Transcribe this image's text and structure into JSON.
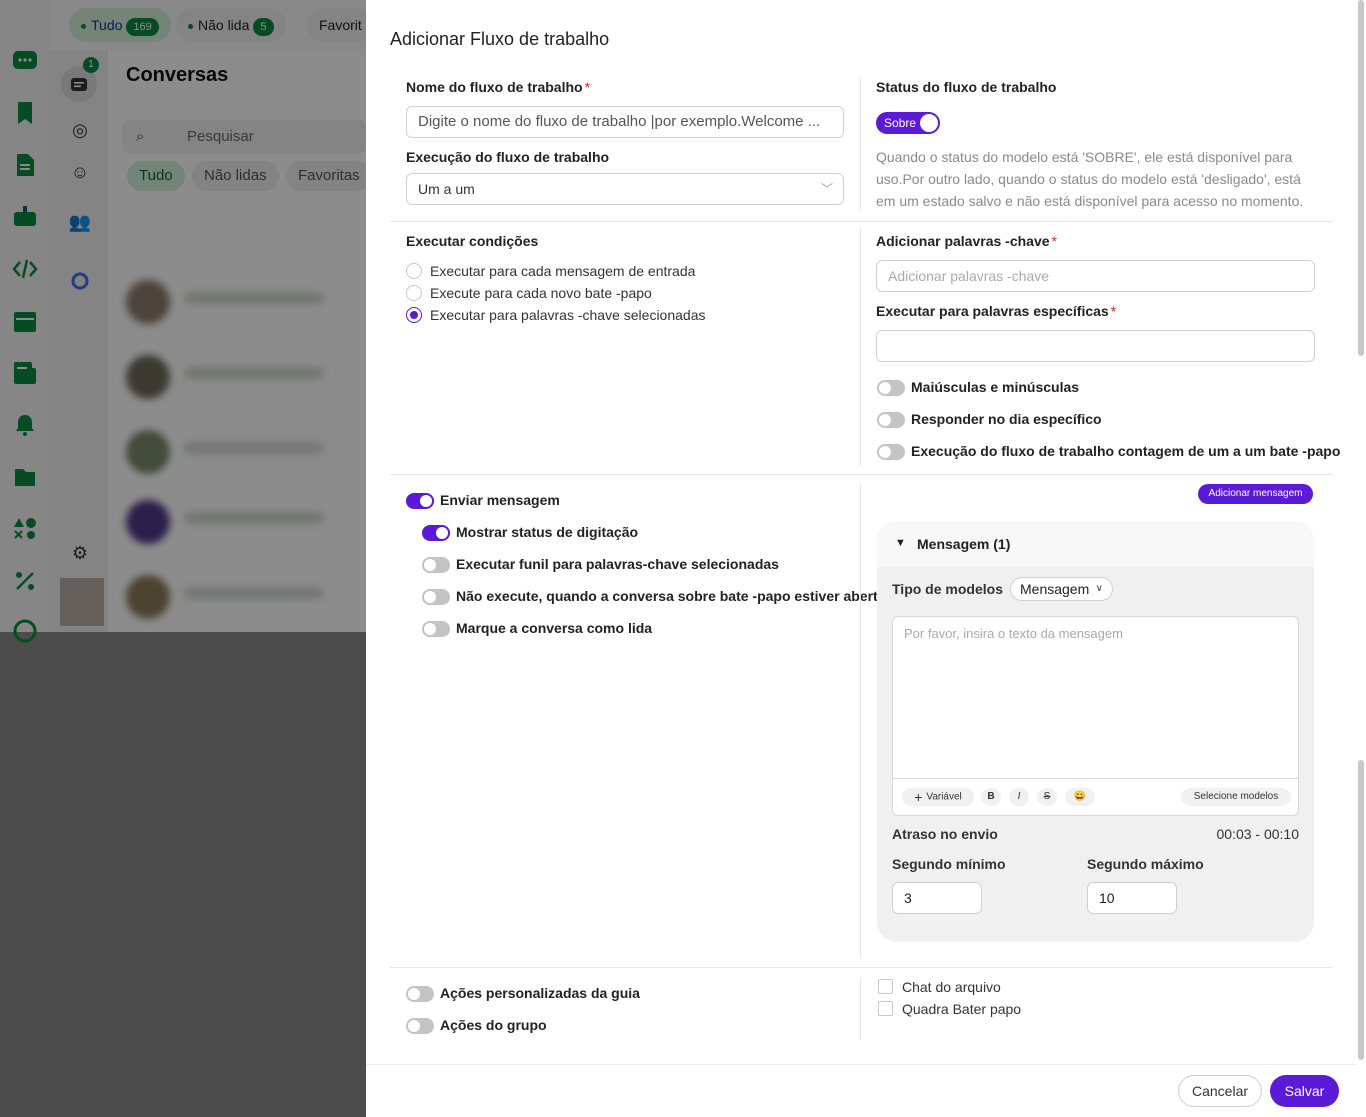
{
  "background_app": {
    "top_tabs": [
      {
        "label": "Tudo",
        "count": "169"
      },
      {
        "label": "Não lida",
        "count": "5"
      },
      {
        "label": "Favorit"
      }
    ],
    "chats_badge": "1",
    "title": "Conversas",
    "search_placeholder": "Pesquisar",
    "filters": [
      "Tudo",
      "Não lidas",
      "Favoritas"
    ]
  },
  "drawer": {
    "title": "Adicionar Fluxo de trabalho",
    "workflow_name": {
      "label": "Nome do fluxo de trabalho",
      "required_mark": "*",
      "placeholder": "Digite o nome do fluxo de trabalho |por exemplo.Welcome ..."
    },
    "execution": {
      "label": "Execução do fluxo de trabalho",
      "value": "Um a um"
    },
    "status": {
      "label": "Status do fluxo de trabalho",
      "toggle_label": "Sobre",
      "enabled": true,
      "description": "Quando o status do modelo está 'SOBRE', ele está disponível para uso.Por outro lado, quando o status do modelo está 'desligado', está em um estado salvo e não está disponível para acesso no momento."
    },
    "conditions": {
      "label": "Executar condições",
      "options": [
        "Executar para cada mensagem de entrada",
        "Execute para cada novo bate -papo",
        "Executar para palavras -chave selecionadas"
      ],
      "selected": "Executar para palavras -chave selecionadas"
    },
    "keywords": {
      "label": "Adicionar palavras -chave",
      "required_mark": "*",
      "placeholder": "Adicionar palavras -chave"
    },
    "specific_words": {
      "label": "Executar para palavras específicas",
      "required_mark": "*",
      "value": ""
    },
    "keyword_toggles": [
      {
        "label": "Maiúsculas e minúsculas",
        "on": false
      },
      {
        "label": "Responder no dia específico",
        "on": false
      },
      {
        "label": "Execução do fluxo de trabalho contagem de um a um bate -papo",
        "on": false
      }
    ],
    "send_message": {
      "label": "Enviar mensagem",
      "on": true
    },
    "message_toggles": [
      {
        "label": "Mostrar status de digitação",
        "on": true
      },
      {
        "label": "Executar funil para palavras-chave selecionadas",
        "on": false
      },
      {
        "label": "Não execute, quando a conversa sobre bate -papo estiver aberta",
        "on": false
      },
      {
        "label": "Marque a conversa como lida",
        "on": false
      }
    ],
    "add_message_button": "Adicionar mensagem",
    "message_card": {
      "title": "Mensagem (1)",
      "template_type_label": "Tipo de modelos",
      "template_type_value": "Mensagem",
      "text_placeholder": "Por favor, insira o texto da mensagem",
      "toolbar": {
        "variable": "Variável",
        "bold": "B",
        "italic": "I",
        "strike": "S",
        "emoji": "😀",
        "select_templates": "Selecione modelos"
      },
      "delay_label": "Atraso no envio",
      "delay_range": "00:03 - 00:10",
      "min_label": "Segundo mínimo",
      "min_value": "3",
      "max_label": "Segundo máximo",
      "max_value": "10"
    },
    "bottom_toggles": [
      {
        "label": "Ações personalizadas da guia",
        "on": false
      },
      {
        "label": "Ações do grupo",
        "on": false
      }
    ],
    "checkboxes": [
      {
        "label": "Chat do arquivo",
        "checked": false
      },
      {
        "label": "Quadra Bater papo",
        "checked": false
      }
    ],
    "footer": {
      "cancel": "Cancelar",
      "save": "Salvar"
    }
  },
  "colors": {
    "accent": "#5b1ad6",
    "brand_green": "#0a8a3f",
    "required": "#e02424"
  }
}
